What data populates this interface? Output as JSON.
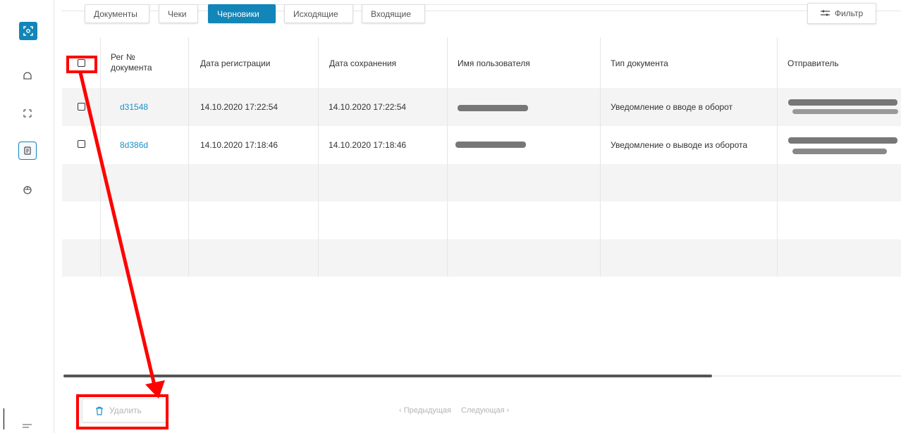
{
  "sidebar": {
    "items": [
      {
        "icon": "home-icon"
      },
      {
        "icon": "scan-icon"
      },
      {
        "icon": "document-icon",
        "active": true
      },
      {
        "icon": "package-icon"
      }
    ],
    "accent": "#1286b8"
  },
  "tabs": [
    {
      "label": "Документы",
      "active": false
    },
    {
      "label": "Чеки",
      "active": false
    },
    {
      "label": "Черновики",
      "active": true
    },
    {
      "label": "Исходящие",
      "active": false
    },
    {
      "label": "Входящие",
      "active": false
    }
  ],
  "filter_label": "Фильтр",
  "table": {
    "headers": {
      "reg_no_line1": "Рег №",
      "reg_no_line2": "документа",
      "reg_date": "Дата регистрации",
      "save_date": "Дата сохранения",
      "user": "Имя пользователя",
      "doc_type": "Тип документа",
      "sender": "Отправитель"
    },
    "rows": [
      {
        "reg_no": "d31548",
        "reg_date": "14.10.2020 17:22:54",
        "save_date": "14.10.2020 17:22:54",
        "doc_type": "Уведомление о вводе в оборот"
      },
      {
        "reg_no": "8d386d",
        "reg_date": "14.10.2020 17:18:46",
        "save_date": "14.10.2020 17:18:46",
        "doc_type": "Уведомление о выводе из оборота"
      }
    ]
  },
  "footer": {
    "delete_label": "Удалить",
    "prev_label": "‹ Предыдущая",
    "next_label": "Следующая ›"
  },
  "annotation_color": "#ff0000"
}
